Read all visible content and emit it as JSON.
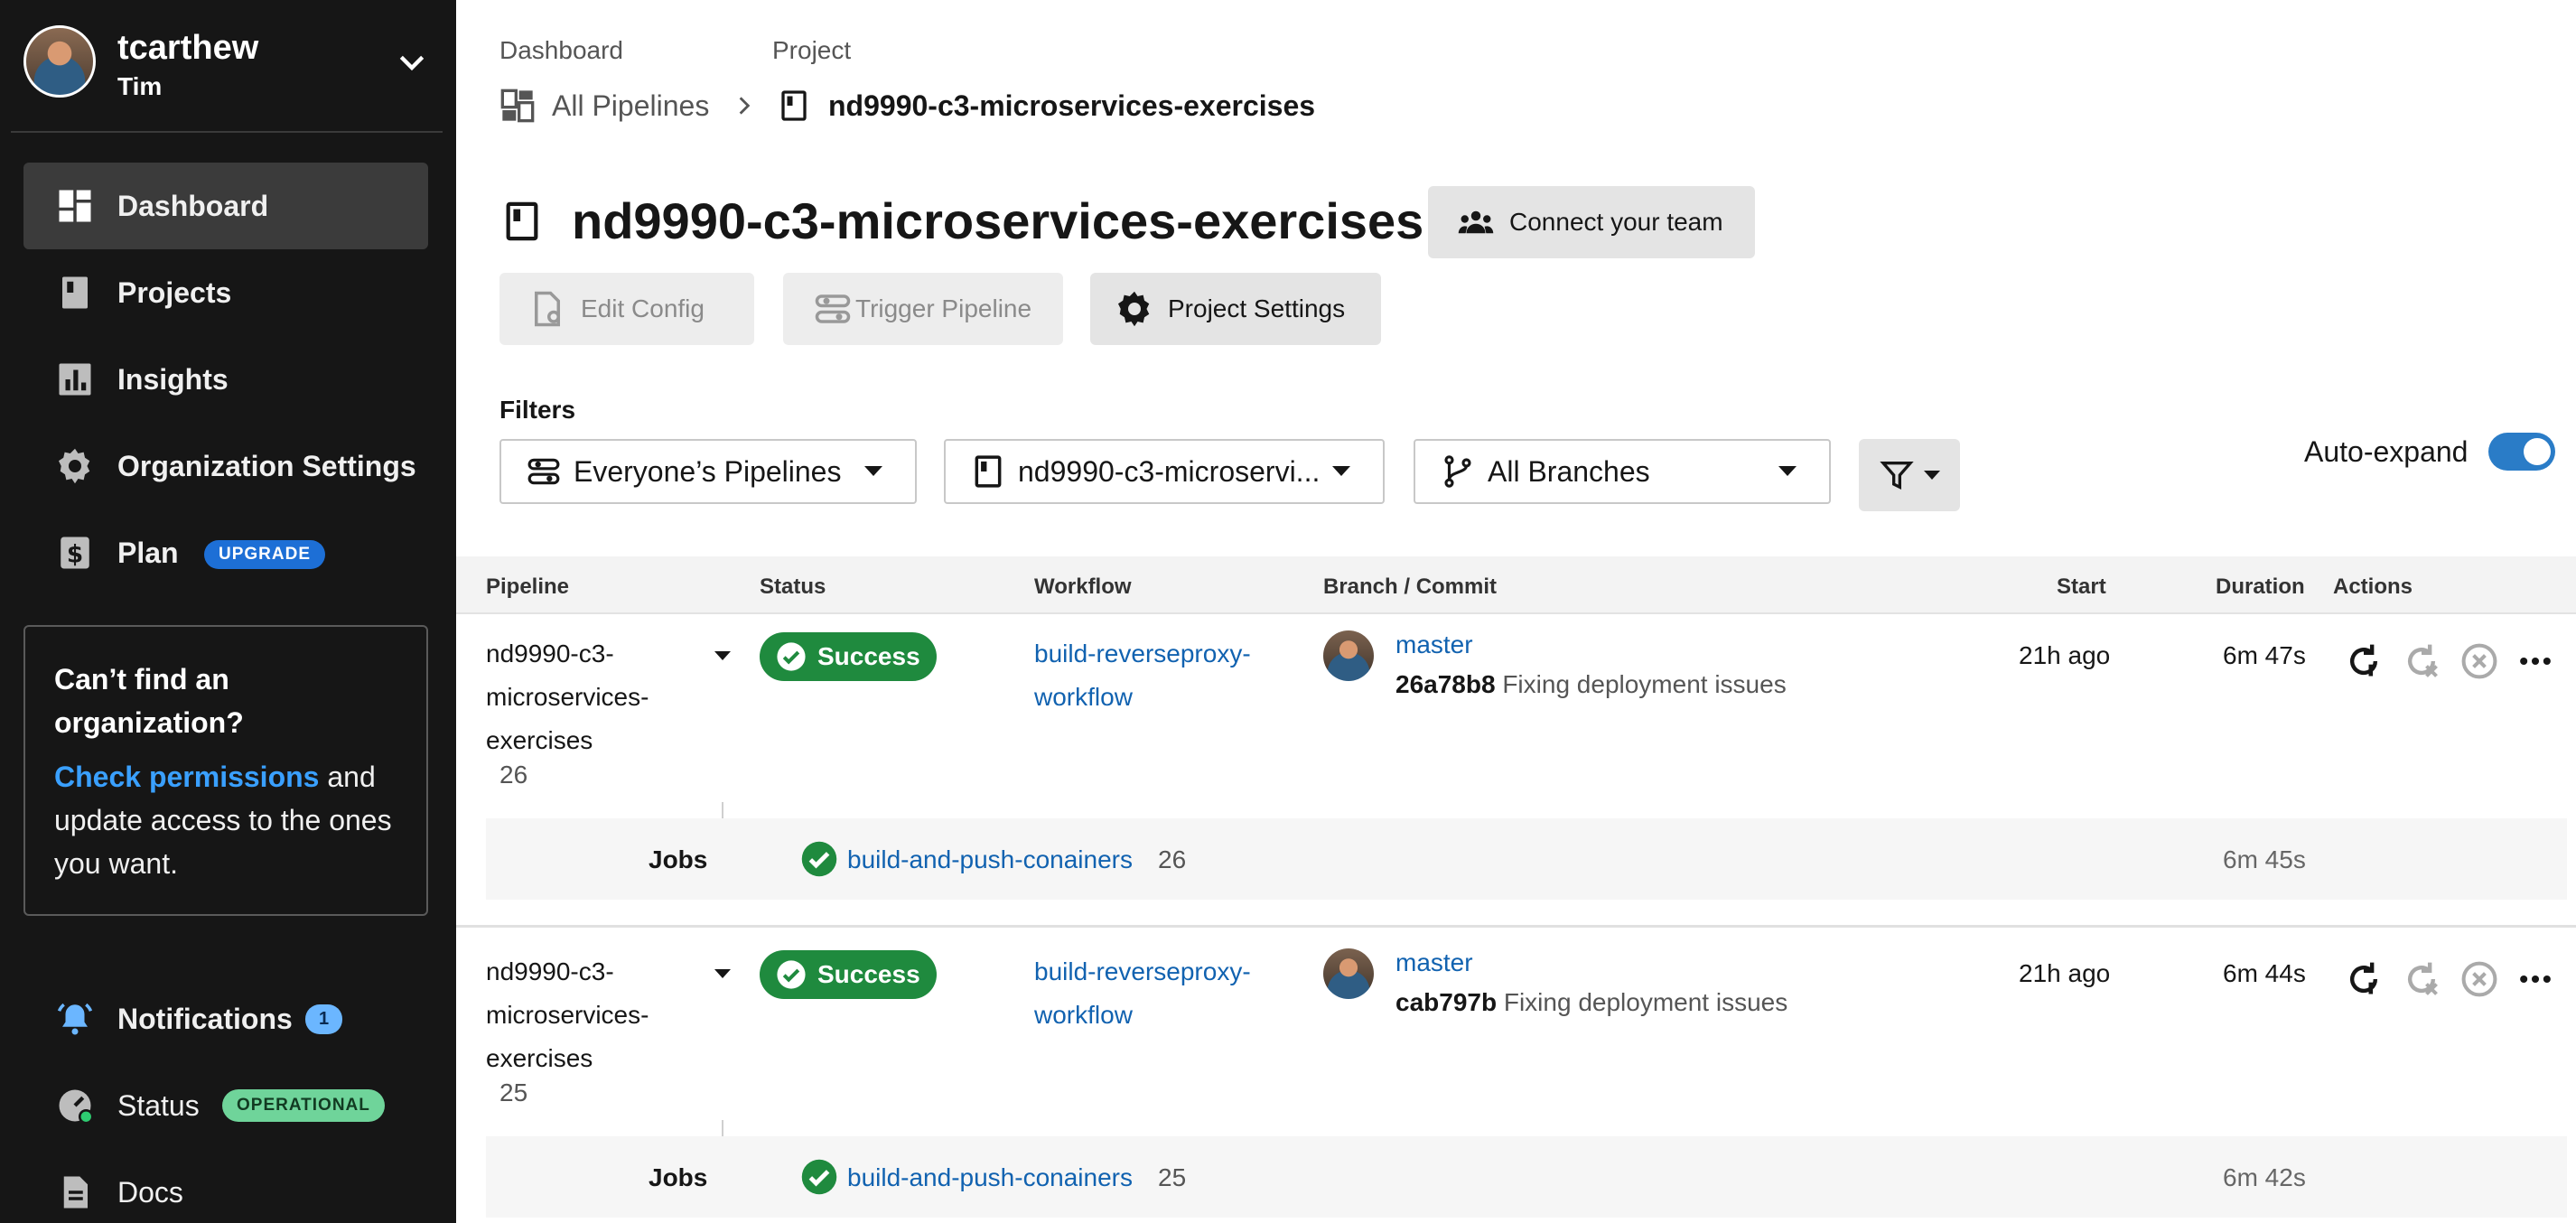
{
  "user": {
    "name": "tcarthew",
    "subtitle": "Tim"
  },
  "sidebar": {
    "items": [
      {
        "label": "Dashboard",
        "icon": "dashboard-icon",
        "active": true
      },
      {
        "label": "Projects",
        "icon": "projects-icon"
      },
      {
        "label": "Insights",
        "icon": "insights-icon"
      },
      {
        "label": "Organization Settings",
        "icon": "gear-icon"
      },
      {
        "label": "Plan",
        "icon": "dollar-icon",
        "badge": "UPGRADE"
      }
    ],
    "org_box": {
      "title": "Can’t find an organization?",
      "link": "Check permissions",
      "body": " and update access to the ones you want."
    },
    "bottom": [
      {
        "label": "Notifications",
        "icon": "bell-icon",
        "badge": "1"
      },
      {
        "label": "Status",
        "icon": "status-gauge-icon",
        "badge": "OPERATIONAL"
      },
      {
        "label": "Docs",
        "icon": "docs-icon"
      }
    ]
  },
  "breadcrumb": {
    "head_dashboard": "Dashboard",
    "head_project": "Project",
    "all_pipelines": "All Pipelines",
    "project": "nd9990-c3-microservices-exercises"
  },
  "page": {
    "title": "nd9990-c3-microservices-exercises",
    "connect_team": "Connect your team",
    "edit_config": "Edit Config",
    "trigger_pipeline": "Trigger Pipeline",
    "project_settings": "Project Settings"
  },
  "filters": {
    "label": "Filters",
    "pipelines": "Everyone’s Pipelines",
    "project": "nd9990-c3-microservi...",
    "branches": "All Branches",
    "auto_expand": "Auto-expand",
    "auto_expand_on": true
  },
  "table": {
    "headers": [
      "Pipeline",
      "Status",
      "Workflow",
      "Branch / Commit",
      "Start",
      "Duration",
      "Actions"
    ],
    "rows": [
      {
        "pipeline_lines": [
          "nd9990-c3-",
          "microservices-",
          "exercises"
        ],
        "number": "26",
        "status": "Success",
        "workflow_lines": [
          "build-reverseproxy-",
          "workflow"
        ],
        "branch": "master",
        "commit_hash": "26a78b8",
        "commit_msg": "Fixing deployment issues",
        "start": "21h ago",
        "duration": "6m 47s",
        "jobs_label": "Jobs",
        "job_name": "build-and-push-conainers",
        "job_number": "26",
        "job_duration": "6m 45s"
      },
      {
        "pipeline_lines": [
          "nd9990-c3-",
          "microservices-",
          "exercises"
        ],
        "number": "25",
        "status": "Success",
        "workflow_lines": [
          "build-reverseproxy-",
          "workflow"
        ],
        "branch": "master",
        "commit_hash": "cab797b",
        "commit_msg": "Fixing deployment issues",
        "start": "21h ago",
        "duration": "6m 44s",
        "jobs_label": "Jobs",
        "job_name": "build-and-push-conainers",
        "job_number": "25",
        "job_duration": "6m 42s"
      }
    ]
  },
  "colors": {
    "sidebar_bg": "#161616",
    "success": "#1f8a3e",
    "link": "#1162b0",
    "accent": "#2a7cc7"
  }
}
